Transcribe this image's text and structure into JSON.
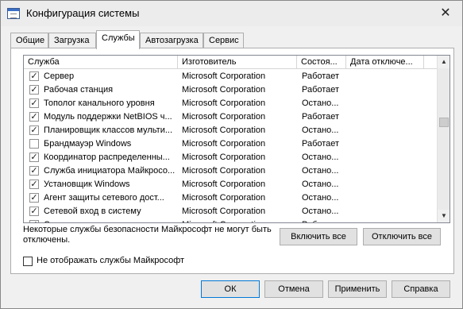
{
  "window": {
    "title": "Конфигурация системы",
    "close_glyph": "✕"
  },
  "tabs": [
    {
      "label": "Общие"
    },
    {
      "label": "Загрузка"
    },
    {
      "label": "Службы",
      "active": true
    },
    {
      "label": "Автозагрузка"
    },
    {
      "label": "Сервис"
    }
  ],
  "services": {
    "columns": [
      "Служба",
      "Изготовитель",
      "Состоя...",
      "Дата отключе..."
    ],
    "rows": [
      {
        "checked": true,
        "name": "Сервер",
        "maker": "Microsoft Corporation",
        "state": "Работает"
      },
      {
        "checked": true,
        "name": "Рабочая станция",
        "maker": "Microsoft Corporation",
        "state": "Работает"
      },
      {
        "checked": true,
        "name": "Тополог канального уровня",
        "maker": "Microsoft Corporation",
        "state": "Остано..."
      },
      {
        "checked": true,
        "name": "Модуль поддержки NetBIOS ч...",
        "maker": "Microsoft Corporation",
        "state": "Работает"
      },
      {
        "checked": true,
        "name": "Планировщик классов мульти...",
        "maker": "Microsoft Corporation",
        "state": "Остано..."
      },
      {
        "checked": false,
        "name": "Брандмауэр Windows",
        "maker": "Microsoft Corporation",
        "state": "Работает"
      },
      {
        "checked": true,
        "name": "Координатор распределенны...",
        "maker": "Microsoft Corporation",
        "state": "Остано..."
      },
      {
        "checked": true,
        "name": "Служба инициатора Майкросо...",
        "maker": "Microsoft Corporation",
        "state": "Остано..."
      },
      {
        "checked": true,
        "name": "Установщик Windows",
        "maker": "Microsoft Corporation",
        "state": "Остано..."
      },
      {
        "checked": true,
        "name": "Агент защиты сетевого дост...",
        "maker": "Microsoft Corporation",
        "state": "Остано..."
      },
      {
        "checked": true,
        "name": "Сетевой вход в систему",
        "maker": "Microsoft Corporation",
        "state": "Остано..."
      },
      {
        "checked": true,
        "name": "С...",
        "maker": "Microsoft Corporation",
        "state": "Работает"
      }
    ]
  },
  "notice": "Некоторые службы безопасности Майкрософт не могут быть отключены.",
  "enable_all": "Включить все",
  "disable_all": "Отключить все",
  "hide_ms_label": "Не отображать службы Майкрософт",
  "hide_ms_checked": false,
  "buttons": {
    "ok": "ОК",
    "cancel": "Отмена",
    "apply": "Применить",
    "help": "Справка"
  },
  "icons": {
    "scroll_up": "▲",
    "scroll_down": "▼",
    "check": "✓"
  }
}
